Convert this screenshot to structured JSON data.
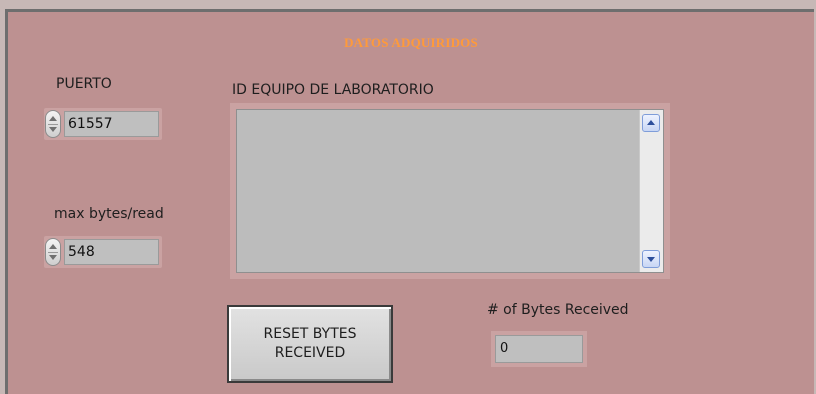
{
  "panel": {
    "title": "DATOS ADQUIRIDOS",
    "title_color": "#ff9a3a",
    "background_color": "#bd9191"
  },
  "puerto": {
    "label": "PUERTO",
    "value": "61557"
  },
  "max_bytes": {
    "label": "max bytes/read",
    "value": "548"
  },
  "id_equipo": {
    "label": "ID EQUIPO DE LABORATORIO",
    "value": ""
  },
  "reset_button": {
    "label": "RESET BYTES\nRECEIVED"
  },
  "bytes_received": {
    "label": "# of Bytes Received",
    "value": "0"
  },
  "icons": [
    "spinner-icon",
    "scroll-up-arrow-icon",
    "scroll-down-arrow-icon"
  ]
}
